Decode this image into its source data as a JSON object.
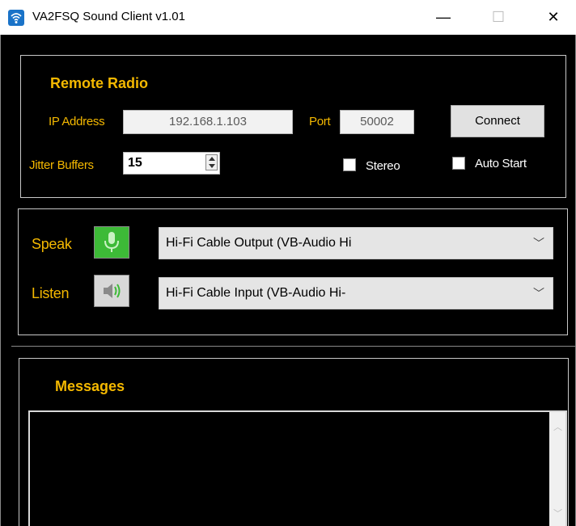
{
  "window": {
    "title": "VA2FSQ Sound Client v1.01",
    "minimize": "—",
    "maximize": "☐",
    "close": "✕"
  },
  "remote_radio": {
    "heading": "Remote Radio",
    "ip_label": "IP Address",
    "ip_value": "192.168.1.103",
    "port_label": "Port",
    "port_value": "50002",
    "connect_label": "Connect",
    "jitter_label": "Jitter Buffers",
    "jitter_value": "15",
    "stereo_label": "Stereo",
    "stereo_checked": false,
    "autostart_label": "Auto Start",
    "autostart_checked": false
  },
  "audio": {
    "speak_label": "Speak",
    "speak_device": "Hi-Fi Cable Output (VB-Audio Hi",
    "listen_label": "Listen",
    "listen_device": "Hi-Fi Cable Input (VB-Audio Hi-",
    "chevron": "﹀"
  },
  "messages": {
    "heading": "Messages",
    "text": ""
  },
  "icons": {
    "app": "wifi-icon",
    "speak": "microphone-icon",
    "listen": "speaker-icon"
  },
  "colors": {
    "label_gold": "#f4b800",
    "background": "#000000",
    "mic_green": "#3dba37",
    "title_icon_blue": "#1a73c8"
  }
}
